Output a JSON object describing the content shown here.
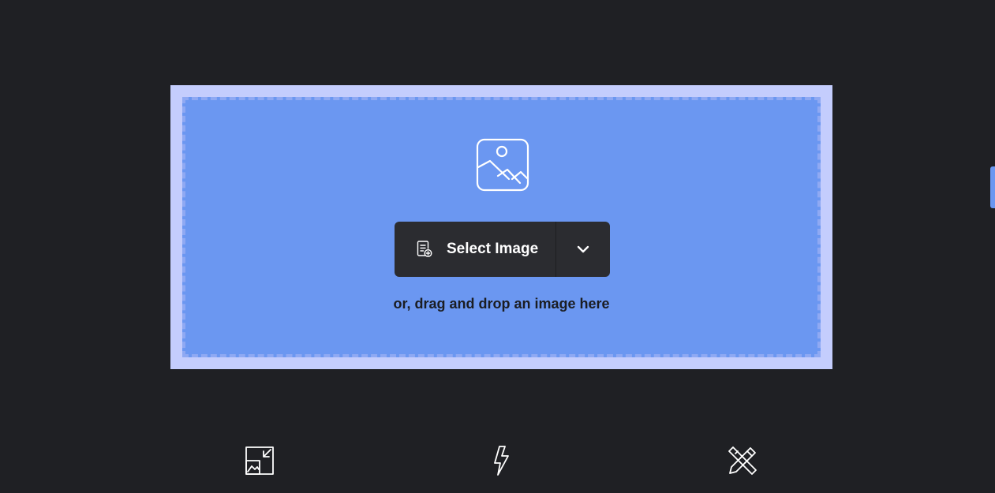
{
  "upload": {
    "select_label": "Select Image",
    "drop_hint": "or, drag and drop an image here"
  },
  "icons": {
    "main": "image-icon",
    "select": "file-add-icon",
    "dropdown": "chevron-down-icon",
    "features": [
      "resize-icon",
      "lightning-icon",
      "pencil-ruler-icon"
    ]
  },
  "colors": {
    "background": "#1f2024",
    "frame": "#c4cdfd",
    "dropzone": "#6b97f1",
    "button": "#2b2c30"
  }
}
